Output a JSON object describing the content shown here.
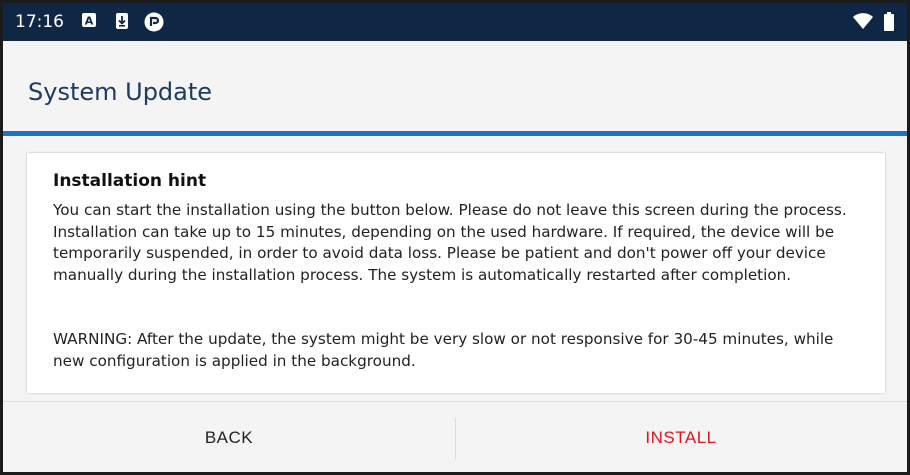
{
  "status_bar": {
    "time": "17:16",
    "icons": [
      "font-a-icon",
      "download-icon",
      "pocket-icon",
      "wifi-icon",
      "battery-icon"
    ]
  },
  "header": {
    "title": "System Update",
    "accent_color": "#1d74c4"
  },
  "hint": {
    "title": "Installation hint",
    "body": "You can start the installation using the button below. Please do not leave this screen during the process. Installation can take up to 15 minutes, depending on the used hardware. If required, the device will be temporarily suspended, in order to avoid data loss. Please be patient and don't power off your device manually during the installation process. The system is automatically restarted after completion.",
    "warning": "WARNING: After the update, the system might be very slow or not responsive for 30-45 minutes, while new configuration is applied in the background."
  },
  "actions": {
    "back_label": "BACK",
    "install_label": "INSTALL",
    "install_color": "#e0141e"
  }
}
